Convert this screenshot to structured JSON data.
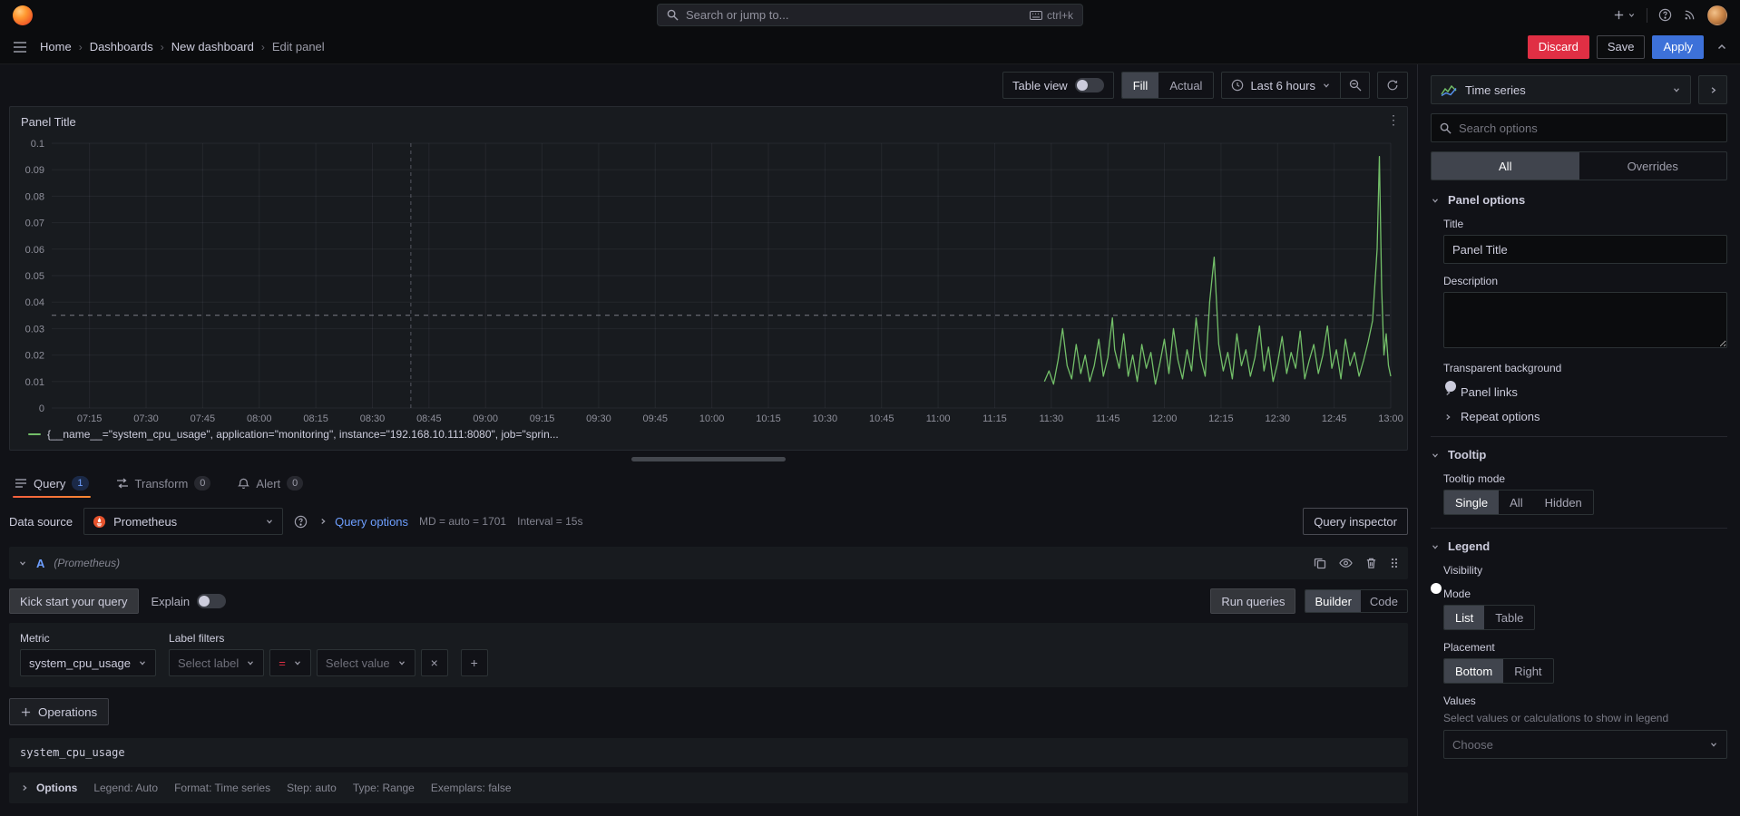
{
  "topnav": {
    "search_placeholder": "Search or jump to...",
    "shortcut": "ctrl+k"
  },
  "breadcrumb": [
    "Home",
    "Dashboards",
    "New dashboard",
    "Edit panel"
  ],
  "header_actions": {
    "discard": "Discard",
    "save": "Save",
    "apply": "Apply"
  },
  "toolbar": {
    "table_view_label": "Table view",
    "size_modes": [
      "Fill",
      "Actual"
    ],
    "size_mode_selected": "Fill",
    "time_range": "Last 6 hours"
  },
  "panel": {
    "title": "Panel Title",
    "series_label": "{__name__=\"system_cpu_usage\", application=\"monitoring\", instance=\"192.168.10.111:8080\", job=\"sprin..."
  },
  "chart_data": {
    "type": "line",
    "title": "Panel Title",
    "xlabel": "",
    "ylabel": "",
    "grid": true,
    "legend_position": "bottom",
    "x_domain_hours": [
      7.083,
      13.0
    ],
    "ylim": [
      0,
      0.1
    ],
    "y_ticks": [
      0,
      0.01,
      0.02,
      0.03,
      0.04,
      0.05,
      0.06,
      0.07,
      0.08,
      0.09,
      0.1
    ],
    "y_tick_labels": [
      "0",
      "0.01",
      "0.02",
      "0.03",
      "0.04",
      "0.05",
      "0.06",
      "0.07",
      "0.08",
      "0.09",
      "0.1"
    ],
    "x_ticks_hours": [
      7.25,
      7.5,
      7.75,
      8.0,
      8.25,
      8.5,
      8.75,
      9.0,
      9.25,
      9.5,
      9.75,
      10.0,
      10.25,
      10.5,
      10.75,
      11.0,
      11.25,
      11.5,
      11.75,
      12.0,
      12.25,
      12.5,
      12.75,
      13.0
    ],
    "x_tick_labels": [
      "07:15",
      "07:30",
      "07:45",
      "08:00",
      "08:15",
      "08:30",
      "08:45",
      "09:00",
      "09:15",
      "09:30",
      "09:45",
      "10:00",
      "10:15",
      "10:30",
      "10:45",
      "11:00",
      "11:15",
      "11:30",
      "11:45",
      "12:00",
      "12:15",
      "12:30",
      "12:45",
      "13:00"
    ],
    "annotations": {
      "h_line_y": 0.035,
      "v_line_x_hours": 8.67
    },
    "series": [
      {
        "name": "{__name__=\"system_cpu_usage\", application=\"monitoring\", instance=\"192.168.10.111:8080\", job=\"sprin...",
        "color": "#73bf69",
        "points": [
          [
            11.47,
            0.01
          ],
          [
            11.49,
            0.014
          ],
          [
            11.51,
            0.009
          ],
          [
            11.53,
            0.018
          ],
          [
            11.55,
            0.03
          ],
          [
            11.57,
            0.016
          ],
          [
            11.59,
            0.011
          ],
          [
            11.61,
            0.024
          ],
          [
            11.63,
            0.013
          ],
          [
            11.65,
            0.02
          ],
          [
            11.67,
            0.01
          ],
          [
            11.69,
            0.016
          ],
          [
            11.71,
            0.026
          ],
          [
            11.73,
            0.012
          ],
          [
            11.75,
            0.019
          ],
          [
            11.77,
            0.034
          ],
          [
            11.78,
            0.022
          ],
          [
            11.8,
            0.015
          ],
          [
            11.82,
            0.028
          ],
          [
            11.84,
            0.012
          ],
          [
            11.86,
            0.02
          ],
          [
            11.88,
            0.01
          ],
          [
            11.9,
            0.024
          ],
          [
            11.92,
            0.015
          ],
          [
            11.94,
            0.021
          ],
          [
            11.96,
            0.009
          ],
          [
            11.98,
            0.017
          ],
          [
            12.0,
            0.026
          ],
          [
            12.02,
            0.013
          ],
          [
            12.04,
            0.03
          ],
          [
            12.06,
            0.018
          ],
          [
            12.08,
            0.011
          ],
          [
            12.1,
            0.022
          ],
          [
            12.12,
            0.014
          ],
          [
            12.14,
            0.034
          ],
          [
            12.16,
            0.019
          ],
          [
            12.18,
            0.012
          ],
          [
            12.2,
            0.04
          ],
          [
            12.22,
            0.057
          ],
          [
            12.24,
            0.024
          ],
          [
            12.26,
            0.014
          ],
          [
            12.28,
            0.021
          ],
          [
            12.3,
            0.011
          ],
          [
            12.32,
            0.028
          ],
          [
            12.34,
            0.016
          ],
          [
            12.36,
            0.022
          ],
          [
            12.38,
            0.012
          ],
          [
            12.4,
            0.019
          ],
          [
            12.42,
            0.031
          ],
          [
            12.44,
            0.014
          ],
          [
            12.46,
            0.023
          ],
          [
            12.48,
            0.01
          ],
          [
            12.5,
            0.017
          ],
          [
            12.52,
            0.027
          ],
          [
            12.54,
            0.013
          ],
          [
            12.56,
            0.021
          ],
          [
            12.58,
            0.015
          ],
          [
            12.6,
            0.029
          ],
          [
            12.62,
            0.011
          ],
          [
            12.64,
            0.018
          ],
          [
            12.66,
            0.024
          ],
          [
            12.68,
            0.013
          ],
          [
            12.7,
            0.02
          ],
          [
            12.72,
            0.031
          ],
          [
            12.74,
            0.015
          ],
          [
            12.76,
            0.022
          ],
          [
            12.78,
            0.011
          ],
          [
            12.8,
            0.026
          ],
          [
            12.82,
            0.016
          ],
          [
            12.84,
            0.021
          ],
          [
            12.86,
            0.012
          ],
          [
            12.88,
            0.018
          ],
          [
            12.9,
            0.025
          ],
          [
            12.92,
            0.033
          ],
          [
            12.94,
            0.06
          ],
          [
            12.95,
            0.095
          ],
          [
            12.96,
            0.045
          ],
          [
            12.97,
            0.02
          ],
          [
            12.98,
            0.028
          ],
          [
            12.99,
            0.016
          ],
          [
            13.0,
            0.012
          ]
        ]
      }
    ]
  },
  "editor_tabs": [
    {
      "label": "Query",
      "badge": "1"
    },
    {
      "label": "Transform",
      "badge": "0"
    },
    {
      "label": "Alert",
      "badge": "0"
    }
  ],
  "query": {
    "datasource_label": "Data source",
    "datasource_name": "Prometheus",
    "options_toggle": "Query options",
    "options_md": "MD = auto = 1701",
    "options_interval": "Interval = 15s",
    "inspector_button": "Query inspector",
    "ref_id": "A",
    "ref_ds": "(Prometheus)",
    "kickstart_button": "Kick start your query",
    "explain_label": "Explain",
    "run_button": "Run queries",
    "editor_modes": [
      "Builder",
      "Code"
    ],
    "editor_mode_selected": "Builder",
    "metric_label": "Metric",
    "metric_value": "system_cpu_usage",
    "label_filters_label": "Label filters",
    "select_label_placeholder": "Select label",
    "operator_value": "=",
    "select_value_placeholder": "Select value",
    "operations_button": "Operations",
    "raw_query": "system_cpu_usage",
    "options_label": "Options",
    "options_items": [
      "Legend: Auto",
      "Format: Time series",
      "Step: auto",
      "Type: Range",
      "Exemplars: false"
    ]
  },
  "options_pane": {
    "viz_name": "Time series",
    "search_placeholder": "Search options",
    "tabs": [
      "All",
      "Overrides"
    ],
    "active_tab": "All",
    "panel_options": {
      "header": "Panel options",
      "title_label": "Title",
      "title_value": "Panel Title",
      "description_label": "Description",
      "transparent_label": "Transparent background",
      "panel_links": "Panel links",
      "repeat_options": "Repeat options"
    },
    "tooltip": {
      "header": "Tooltip",
      "mode_label": "Tooltip mode",
      "modes": [
        "Single",
        "All",
        "Hidden"
      ],
      "selected": "Single"
    },
    "legend": {
      "header": "Legend",
      "visibility_label": "Visibility",
      "mode_label": "Mode",
      "modes": [
        "List",
        "Table"
      ],
      "mode_selected": "List",
      "placement_label": "Placement",
      "placements": [
        "Bottom",
        "Right"
      ],
      "placement_selected": "Bottom",
      "values_label": "Values",
      "values_desc": "Select values or calculations to show in legend",
      "values_placeholder": "Choose"
    }
  },
  "colors": {
    "accent_blue": "#3d71d9",
    "series_green": "#73bf69",
    "brand_orange": "#ff8833",
    "destructive_red": "#e02f44",
    "panel_bg": "#181b1f",
    "canvas_bg": "#111217"
  }
}
